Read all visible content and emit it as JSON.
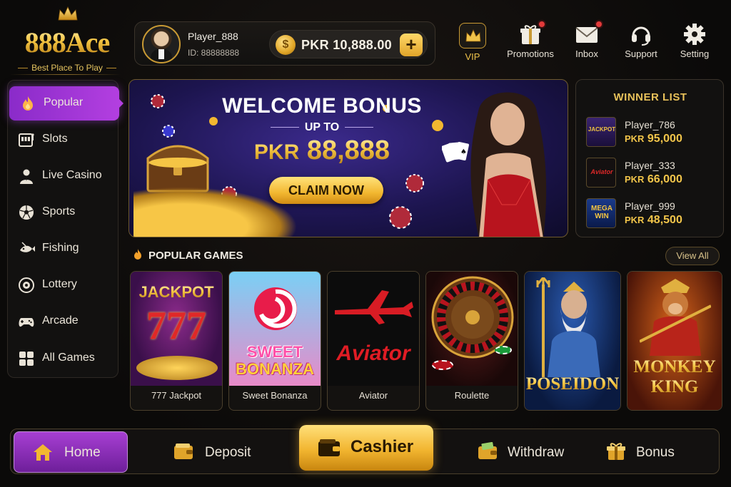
{
  "brand": {
    "name": "888Ace",
    "tagline": "Best Place To Play"
  },
  "player": {
    "name": "Player_888",
    "id_label": "ID: 88888888"
  },
  "balance": {
    "value": "PKR 10,888.00",
    "currency_icon": "rupee-coin-icon",
    "add_label": "+"
  },
  "topnav": [
    {
      "label": "VIP",
      "icon": "crown-icon"
    },
    {
      "label": "Promotions",
      "icon": "gift-icon",
      "notification": true
    },
    {
      "label": "Inbox",
      "icon": "envelope-icon",
      "notification": true
    },
    {
      "label": "Support",
      "icon": "headset-icon"
    },
    {
      "label": "Setting",
      "icon": "gear-icon"
    }
  ],
  "sidebar": {
    "active": "Popular",
    "items": [
      {
        "label": "Popular",
        "icon": "flame-icon"
      },
      {
        "label": "Slots",
        "icon": "slot-machine-icon"
      },
      {
        "label": "Live Casino",
        "icon": "dealer-icon"
      },
      {
        "label": "Sports",
        "icon": "soccer-ball-icon"
      },
      {
        "label": "Fishing",
        "icon": "fish-icon"
      },
      {
        "label": "Lottery",
        "icon": "lottery-ball-icon"
      },
      {
        "label": "Arcade",
        "icon": "gamepad-icon"
      },
      {
        "label": "All Games",
        "icon": "grid-icon"
      }
    ]
  },
  "banner": {
    "title": "WELCOME BONUS",
    "subtitle": "UP TO",
    "currency": "PKR",
    "amount": "88,888",
    "cta": "CLAIM NOW"
  },
  "winners": {
    "title": "WINNER LIST",
    "rows": [
      {
        "name": "Player_786",
        "currency": "PKR",
        "amount": "95,000",
        "game_badge": "JACKPOT"
      },
      {
        "name": "Player_333",
        "currency": "PKR",
        "amount": "66,000",
        "game_badge": "Aviator"
      },
      {
        "name": "Player_999",
        "currency": "PKR",
        "amount": "48,500",
        "game_badge": "MEGA WIN"
      }
    ]
  },
  "popular": {
    "title": "POPULAR GAMES",
    "view_all": "View All",
    "games": [
      {
        "name": "777 Jackpot",
        "art_text": "JACKPOT"
      },
      {
        "name": "Sweet Bonanza",
        "art_text_1": "SWEET",
        "art_text_2": "BONANZA"
      },
      {
        "name": "Aviator",
        "art_text": "Aviator"
      },
      {
        "name": "Roulette"
      },
      {
        "art_text": "POSEIDON"
      },
      {
        "art_text_1": "MONKEY",
        "art_text_2": "KING"
      }
    ]
  },
  "bottombar": {
    "active": "Home",
    "items": [
      {
        "label": "Home",
        "icon": "home-icon"
      },
      {
        "label": "Deposit",
        "icon": "wallet-icon"
      },
      {
        "label": "Cashier",
        "icon": "wallet-icon"
      },
      {
        "label": "Withdraw",
        "icon": "wallet-cash-icon"
      },
      {
        "label": "Bonus",
        "icon": "gift-icon"
      }
    ]
  },
  "colors": {
    "accent_gold": "#f2b730",
    "accent_purple": "#9b35cf",
    "background": "#0d0c0b"
  }
}
